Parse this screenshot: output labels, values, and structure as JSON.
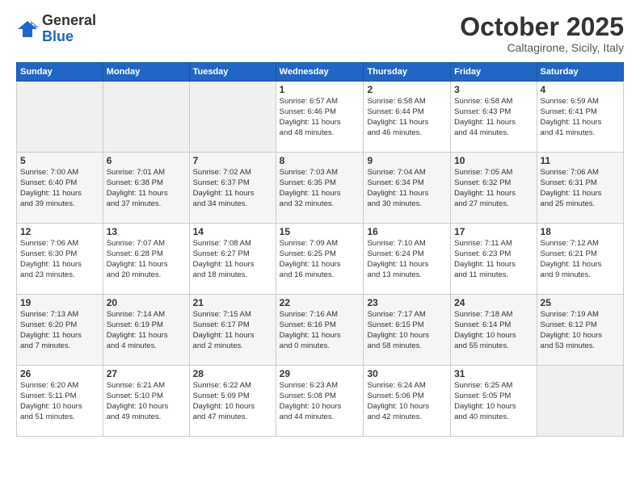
{
  "logo": {
    "general": "General",
    "blue": "Blue"
  },
  "title": "October 2025",
  "location": "Caltagirone, Sicily, Italy",
  "days_header": [
    "Sunday",
    "Monday",
    "Tuesday",
    "Wednesday",
    "Thursday",
    "Friday",
    "Saturday"
  ],
  "weeks": [
    [
      {
        "day": "",
        "info": ""
      },
      {
        "day": "",
        "info": ""
      },
      {
        "day": "",
        "info": ""
      },
      {
        "day": "1",
        "info": "Sunrise: 6:57 AM\nSunset: 6:46 PM\nDaylight: 11 hours\nand 48 minutes."
      },
      {
        "day": "2",
        "info": "Sunrise: 6:58 AM\nSunset: 6:44 PM\nDaylight: 11 hours\nand 46 minutes."
      },
      {
        "day": "3",
        "info": "Sunrise: 6:58 AM\nSunset: 6:43 PM\nDaylight: 11 hours\nand 44 minutes."
      },
      {
        "day": "4",
        "info": "Sunrise: 6:59 AM\nSunset: 6:41 PM\nDaylight: 11 hours\nand 41 minutes."
      }
    ],
    [
      {
        "day": "5",
        "info": "Sunrise: 7:00 AM\nSunset: 6:40 PM\nDaylight: 11 hours\nand 39 minutes."
      },
      {
        "day": "6",
        "info": "Sunrise: 7:01 AM\nSunset: 6:38 PM\nDaylight: 11 hours\nand 37 minutes."
      },
      {
        "day": "7",
        "info": "Sunrise: 7:02 AM\nSunset: 6:37 PM\nDaylight: 11 hours\nand 34 minutes."
      },
      {
        "day": "8",
        "info": "Sunrise: 7:03 AM\nSunset: 6:35 PM\nDaylight: 11 hours\nand 32 minutes."
      },
      {
        "day": "9",
        "info": "Sunrise: 7:04 AM\nSunset: 6:34 PM\nDaylight: 11 hours\nand 30 minutes."
      },
      {
        "day": "10",
        "info": "Sunrise: 7:05 AM\nSunset: 6:32 PM\nDaylight: 11 hours\nand 27 minutes."
      },
      {
        "day": "11",
        "info": "Sunrise: 7:06 AM\nSunset: 6:31 PM\nDaylight: 11 hours\nand 25 minutes."
      }
    ],
    [
      {
        "day": "12",
        "info": "Sunrise: 7:06 AM\nSunset: 6:30 PM\nDaylight: 11 hours\nand 23 minutes."
      },
      {
        "day": "13",
        "info": "Sunrise: 7:07 AM\nSunset: 6:28 PM\nDaylight: 11 hours\nand 20 minutes."
      },
      {
        "day": "14",
        "info": "Sunrise: 7:08 AM\nSunset: 6:27 PM\nDaylight: 11 hours\nand 18 minutes."
      },
      {
        "day": "15",
        "info": "Sunrise: 7:09 AM\nSunset: 6:25 PM\nDaylight: 11 hours\nand 16 minutes."
      },
      {
        "day": "16",
        "info": "Sunrise: 7:10 AM\nSunset: 6:24 PM\nDaylight: 11 hours\nand 13 minutes."
      },
      {
        "day": "17",
        "info": "Sunrise: 7:11 AM\nSunset: 6:23 PM\nDaylight: 11 hours\nand 11 minutes."
      },
      {
        "day": "18",
        "info": "Sunrise: 7:12 AM\nSunset: 6:21 PM\nDaylight: 11 hours\nand 9 minutes."
      }
    ],
    [
      {
        "day": "19",
        "info": "Sunrise: 7:13 AM\nSunset: 6:20 PM\nDaylight: 11 hours\nand 7 minutes."
      },
      {
        "day": "20",
        "info": "Sunrise: 7:14 AM\nSunset: 6:19 PM\nDaylight: 11 hours\nand 4 minutes."
      },
      {
        "day": "21",
        "info": "Sunrise: 7:15 AM\nSunset: 6:17 PM\nDaylight: 11 hours\nand 2 minutes."
      },
      {
        "day": "22",
        "info": "Sunrise: 7:16 AM\nSunset: 6:16 PM\nDaylight: 11 hours\nand 0 minutes."
      },
      {
        "day": "23",
        "info": "Sunrise: 7:17 AM\nSunset: 6:15 PM\nDaylight: 10 hours\nand 58 minutes."
      },
      {
        "day": "24",
        "info": "Sunrise: 7:18 AM\nSunset: 6:14 PM\nDaylight: 10 hours\nand 55 minutes."
      },
      {
        "day": "25",
        "info": "Sunrise: 7:19 AM\nSunset: 6:12 PM\nDaylight: 10 hours\nand 53 minutes."
      }
    ],
    [
      {
        "day": "26",
        "info": "Sunrise: 6:20 AM\nSunset: 5:11 PM\nDaylight: 10 hours\nand 51 minutes."
      },
      {
        "day": "27",
        "info": "Sunrise: 6:21 AM\nSunset: 5:10 PM\nDaylight: 10 hours\nand 49 minutes."
      },
      {
        "day": "28",
        "info": "Sunrise: 6:22 AM\nSunset: 5:09 PM\nDaylight: 10 hours\nand 47 minutes."
      },
      {
        "day": "29",
        "info": "Sunrise: 6:23 AM\nSunset: 5:08 PM\nDaylight: 10 hours\nand 44 minutes."
      },
      {
        "day": "30",
        "info": "Sunrise: 6:24 AM\nSunset: 5:06 PM\nDaylight: 10 hours\nand 42 minutes."
      },
      {
        "day": "31",
        "info": "Sunrise: 6:25 AM\nSunset: 5:05 PM\nDaylight: 10 hours\nand 40 minutes."
      },
      {
        "day": "",
        "info": ""
      }
    ]
  ]
}
